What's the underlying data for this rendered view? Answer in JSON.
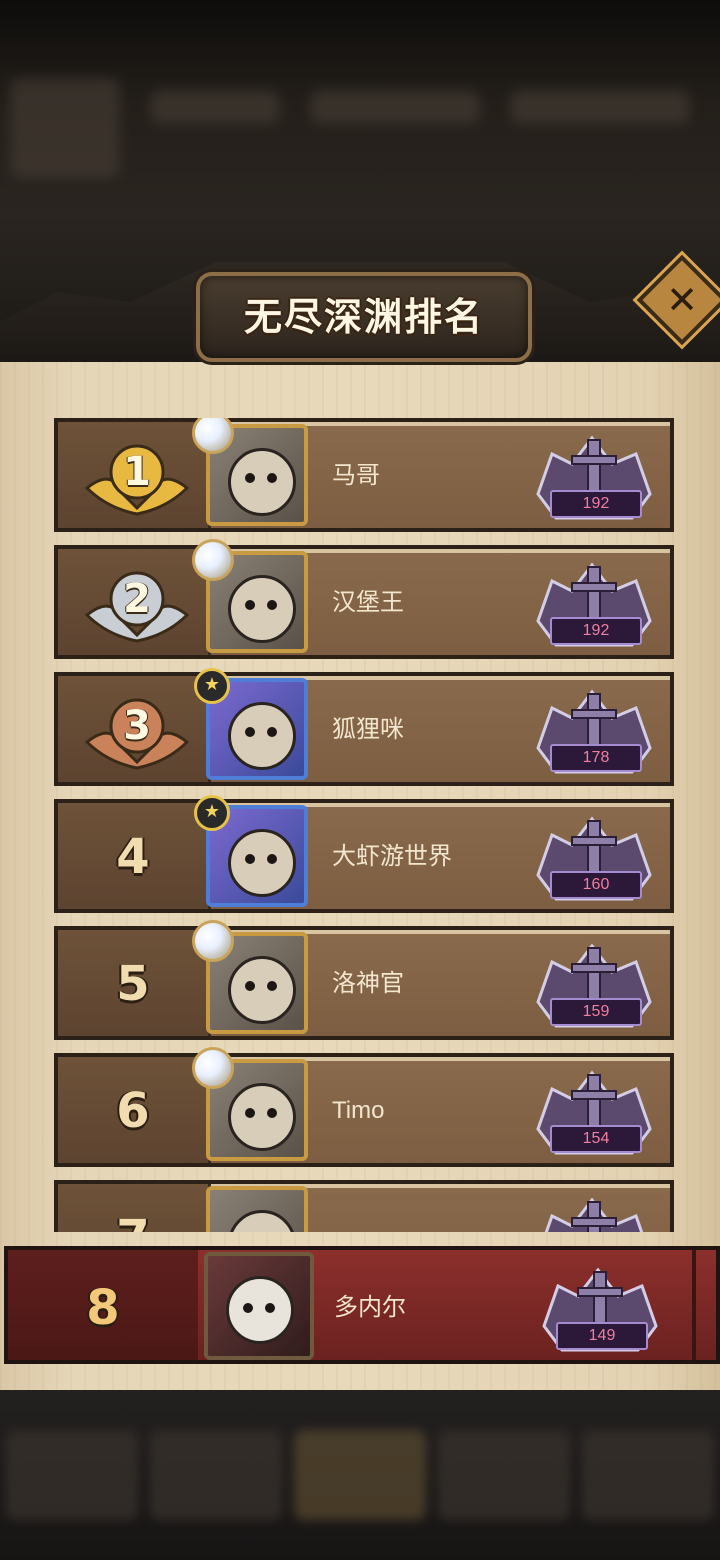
{
  "dialog": {
    "title": "无尽深渊排名",
    "close_icon": "close-icon"
  },
  "ranking": [
    {
      "rank": "1",
      "medal": "gold",
      "name": "马哥",
      "score": "192",
      "frame": "gold",
      "badge": "orb"
    },
    {
      "rank": "2",
      "medal": "silver",
      "name": "汉堡王",
      "score": "192",
      "frame": "gold",
      "badge": "orb"
    },
    {
      "rank": "3",
      "medal": "bronze",
      "name": "狐狸咪",
      "score": "178",
      "frame": "blue",
      "badge": "star"
    },
    {
      "rank": "4",
      "medal": "",
      "name": "大虾游世界",
      "score": "160",
      "frame": "blue",
      "badge": "star"
    },
    {
      "rank": "5",
      "medal": "",
      "name": "洛神官",
      "score": "159",
      "frame": "gold",
      "badge": "orb"
    },
    {
      "rank": "6",
      "medal": "",
      "name": "Timo",
      "score": "154",
      "frame": "gold",
      "badge": "orb"
    },
    {
      "rank": "7",
      "medal": "",
      "name": "",
      "score": "",
      "frame": "gold",
      "badge": ""
    }
  ],
  "my_rank": {
    "rank": "8",
    "name": "多内尔",
    "score": "149"
  },
  "colors": {
    "gold": "#e8b941",
    "silver": "#c9ced4",
    "bronze": "#c9825a",
    "score_text": "#f17fa0"
  }
}
